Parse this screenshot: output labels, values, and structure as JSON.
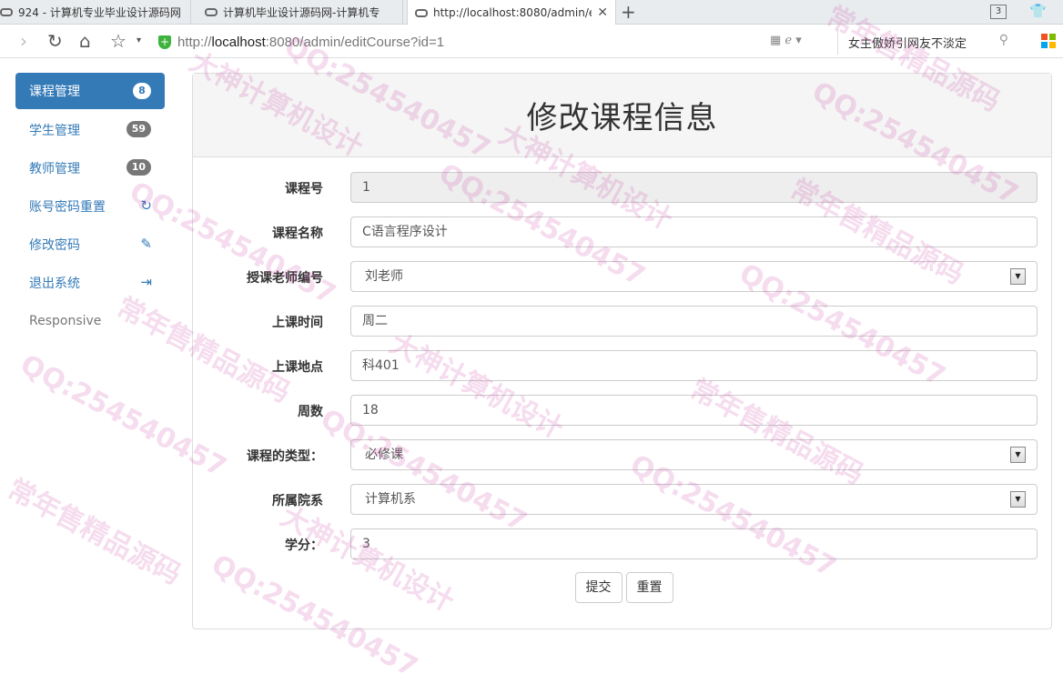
{
  "browser": {
    "tabs": [
      {
        "title": "924 - 计算机专业毕业设计源码网"
      },
      {
        "title": "计算机毕业设计源码网-计算机专"
      },
      {
        "title": "http://localhost:8080/admin/e"
      }
    ],
    "tab_count": "3",
    "url_prefix": "http://",
    "url_host": "localhost",
    "url_rest": ":8080/admin/editCourse?id=1",
    "search_text": "女主傲娇引网友不淡定"
  },
  "sidebar": {
    "items": [
      {
        "label": "课程管理",
        "badge": "8"
      },
      {
        "label": "学生管理",
        "badge": "59"
      },
      {
        "label": "教师管理",
        "badge": "10"
      },
      {
        "label": "账号密码重置",
        "icon": "refresh-icon"
      },
      {
        "label": "修改密码",
        "icon": "pencil-icon"
      },
      {
        "label": "退出系统",
        "icon": "logout-icon"
      },
      {
        "label": "Responsive"
      }
    ]
  },
  "form": {
    "title": "修改课程信息",
    "fields": [
      {
        "label": "课程号",
        "value": "1"
      },
      {
        "label": "课程名称",
        "value": "C语言程序设计"
      },
      {
        "label": "授课老师编号",
        "value": "刘老师"
      },
      {
        "label": "上课时间",
        "value": "周二"
      },
      {
        "label": "上课地点",
        "value": "科401"
      },
      {
        "label": "周数",
        "value": "18"
      },
      {
        "label": "课程的类型：",
        "value": "必修课"
      },
      {
        "label": "所属院系",
        "value": "计算机系"
      },
      {
        "label": "学分：",
        "value": "3"
      }
    ],
    "submit_label": "提交",
    "reset_label": "重置"
  },
  "watermark": {
    "qq": "QQ:254540457",
    "shop": "常年售精品源码",
    "design": "大神计算机设计"
  },
  "colors": {
    "primary": "#337ab7",
    "badge": "#777777",
    "watermark": "#c83ca0"
  }
}
